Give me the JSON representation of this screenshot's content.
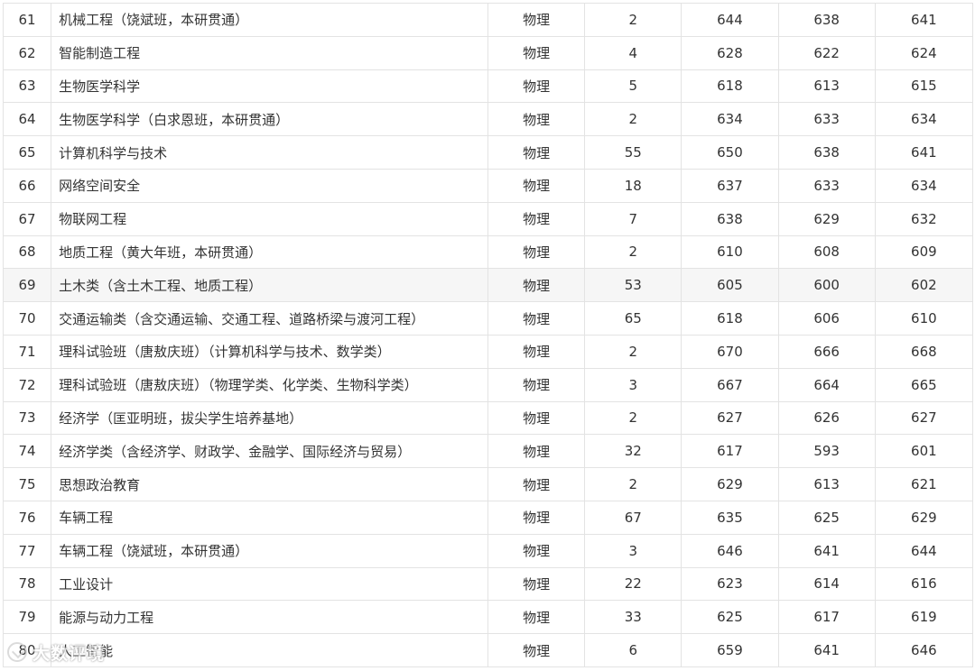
{
  "table": {
    "rows": [
      {
        "idx": "61",
        "major": "机械工程（饶斌班，本研贯通）",
        "subject": "物理",
        "count": "2",
        "max": "644",
        "min": "638",
        "avg": "641"
      },
      {
        "idx": "62",
        "major": "智能制造工程",
        "subject": "物理",
        "count": "4",
        "max": "628",
        "min": "622",
        "avg": "624"
      },
      {
        "idx": "63",
        "major": "生物医学科学",
        "subject": "物理",
        "count": "5",
        "max": "618",
        "min": "613",
        "avg": "615"
      },
      {
        "idx": "64",
        "major": "生物医学科学（白求恩班，本研贯通）",
        "subject": "物理",
        "count": "2",
        "max": "634",
        "min": "633",
        "avg": "634"
      },
      {
        "idx": "65",
        "major": "计算机科学与技术",
        "subject": "物理",
        "count": "55",
        "max": "650",
        "min": "638",
        "avg": "641"
      },
      {
        "idx": "66",
        "major": "网络空间安全",
        "subject": "物理",
        "count": "18",
        "max": "637",
        "min": "633",
        "avg": "634"
      },
      {
        "idx": "67",
        "major": "物联网工程",
        "subject": "物理",
        "count": "7",
        "max": "638",
        "min": "629",
        "avg": "632"
      },
      {
        "idx": "68",
        "major": "地质工程（黄大年班，本研贯通）",
        "subject": "物理",
        "count": "2",
        "max": "610",
        "min": "608",
        "avg": "609"
      },
      {
        "idx": "69",
        "major": "土木类（含土木工程、地质工程）",
        "subject": "物理",
        "count": "53",
        "max": "605",
        "min": "600",
        "avg": "602"
      },
      {
        "idx": "70",
        "major": "交通运输类（含交通运输、交通工程、道路桥梁与渡河工程）",
        "subject": "物理",
        "count": "65",
        "max": "618",
        "min": "606",
        "avg": "610"
      },
      {
        "idx": "71",
        "major": "理科试验班（唐敖庆班）（计算机科学与技术、数学类）",
        "subject": "物理",
        "count": "2",
        "max": "670",
        "min": "666",
        "avg": "668"
      },
      {
        "idx": "72",
        "major": "理科试验班（唐敖庆班）（物理学类、化学类、生物科学类）",
        "subject": "物理",
        "count": "3",
        "max": "667",
        "min": "664",
        "avg": "665"
      },
      {
        "idx": "73",
        "major": "经济学（匡亚明班，拔尖学生培养基地）",
        "subject": "物理",
        "count": "2",
        "max": "627",
        "min": "626",
        "avg": "627"
      },
      {
        "idx": "74",
        "major": "经济学类（含经济学、财政学、金融学、国际经济与贸易）",
        "subject": "物理",
        "count": "32",
        "max": "617",
        "min": "593",
        "avg": "601"
      },
      {
        "idx": "75",
        "major": "思想政治教育",
        "subject": "物理",
        "count": "2",
        "max": "629",
        "min": "613",
        "avg": "621"
      },
      {
        "idx": "76",
        "major": "车辆工程",
        "subject": "物理",
        "count": "67",
        "max": "635",
        "min": "625",
        "avg": "629"
      },
      {
        "idx": "77",
        "major": "车辆工程（饶斌班，本研贯通）",
        "subject": "物理",
        "count": "3",
        "max": "646",
        "min": "641",
        "avg": "644"
      },
      {
        "idx": "78",
        "major": "工业设计",
        "subject": "物理",
        "count": "22",
        "max": "623",
        "min": "614",
        "avg": "616"
      },
      {
        "idx": "79",
        "major": "能源与动力工程",
        "subject": "物理",
        "count": "33",
        "max": "625",
        "min": "617",
        "avg": "619"
      },
      {
        "idx": "80",
        "major": "人工智能",
        "subject": "物理",
        "count": "6",
        "max": "659",
        "min": "641",
        "avg": "646"
      }
    ]
  },
  "watermark": {
    "text": "大数评境",
    "icon": "logo-icon"
  }
}
